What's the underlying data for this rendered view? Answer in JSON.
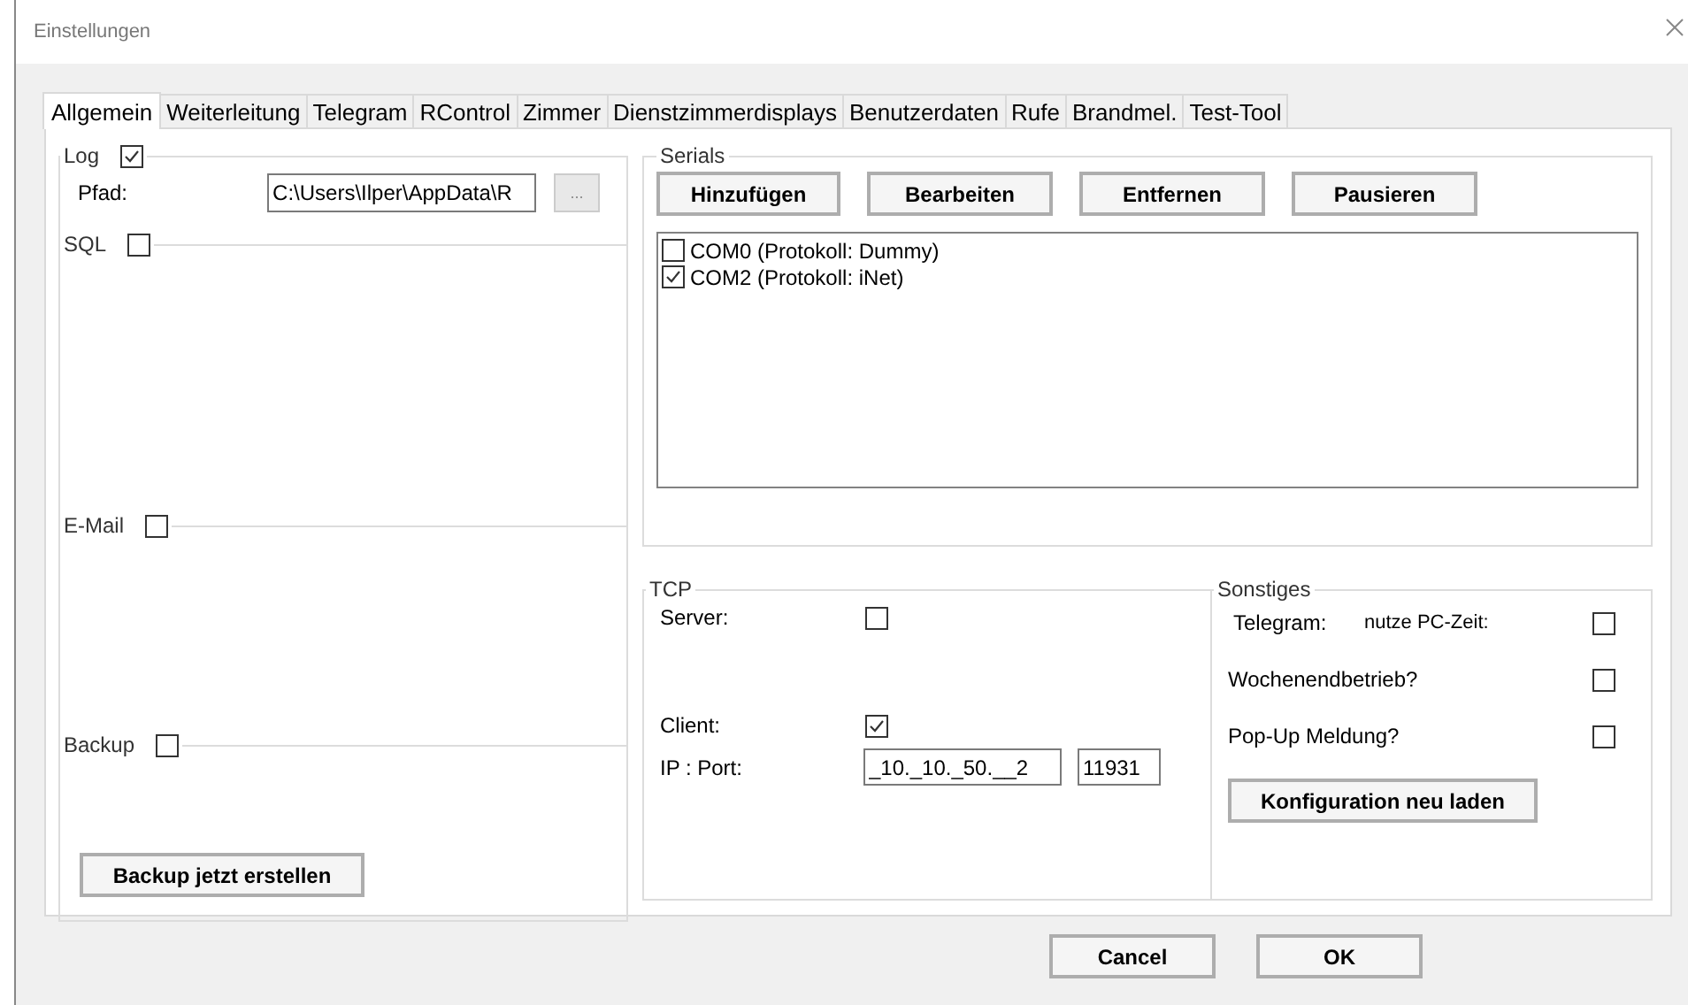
{
  "window": {
    "title": "Einstellungen"
  },
  "tabs": [
    {
      "label": "Allgemein",
      "selected": true
    },
    {
      "label": "Weiterleitung",
      "selected": false
    },
    {
      "label": "Telegram",
      "selected": false
    },
    {
      "label": "RControl",
      "selected": false
    },
    {
      "label": "Zimmer",
      "selected": false
    },
    {
      "label": "Dienstzimmerdisplays",
      "selected": false
    },
    {
      "label": "Benutzerdaten",
      "selected": false
    },
    {
      "label": "Rufe",
      "selected": false
    },
    {
      "label": "Brandmel.",
      "selected": false
    },
    {
      "label": "Test-Tool",
      "selected": false
    }
  ],
  "general": {
    "log": {
      "label": "Log",
      "checked": true,
      "path_label": "Pfad:",
      "path": "C:\\Users\\Ilper\\AppData\\R",
      "browse_button": "..."
    },
    "sql": {
      "label": "SQL",
      "checked": false
    },
    "email": {
      "label": "E-Mail",
      "checked": false
    },
    "backup": {
      "label": "Backup",
      "checked": false,
      "button": "Backup jetzt erstellen"
    }
  },
  "serials": {
    "title": "Serials",
    "buttons": [
      "Hinzufügen",
      "Bearbeiten",
      "Entfernen",
      "Pausieren"
    ],
    "ports": [
      {
        "label": "COM0 (Protokoll: Dummy)",
        "checked": false
      },
      {
        "label": "COM2 (Protokoll: iNet)",
        "checked": true
      }
    ]
  },
  "tcp": {
    "title": "TCP",
    "server": {
      "label": "Server:",
      "checked": false
    },
    "client": {
      "label": "Client:",
      "checked": true
    },
    "address_label": "IP : Port:",
    "ip": "_10._10._50.__2",
    "port": "11931"
  },
  "misc": {
    "title": "Sonstiges",
    "telegram_label": "Telegram:",
    "options": [
      {
        "label": "nutze PC-Zeit:",
        "checked": false
      },
      {
        "label": "Wochenendbetrieb?",
        "checked": false
      },
      {
        "label": "Pop-Up Meldung?",
        "checked": false
      }
    ],
    "reload_button": "Konfiguration neu laden"
  },
  "buttons": [
    "Cancel",
    "OK"
  ]
}
